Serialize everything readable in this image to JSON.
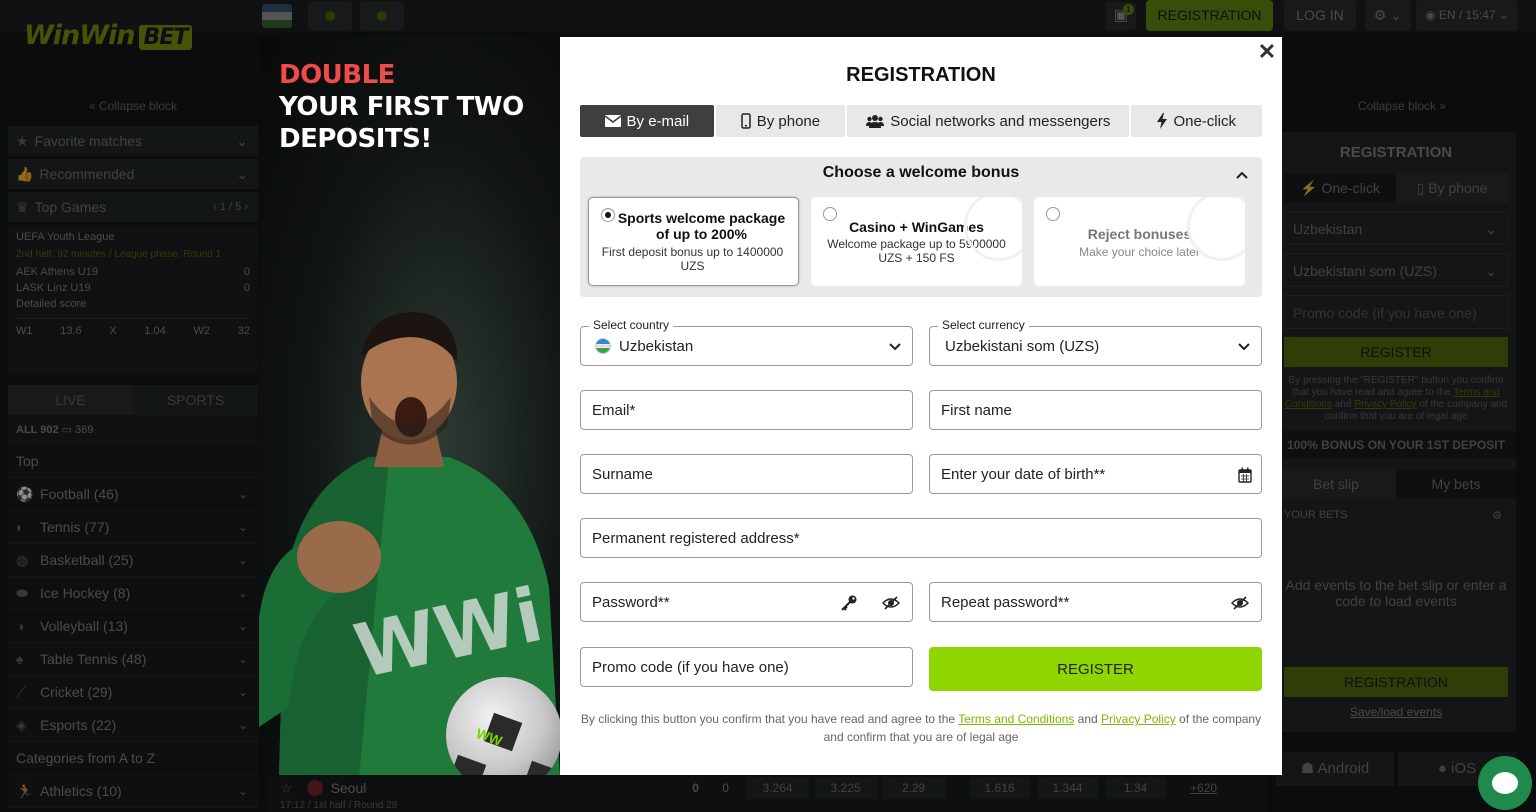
{
  "header": {
    "logo": {
      "part1": "WinWin",
      "part2": "BET"
    },
    "gift_badge": "1",
    "register_label": "REGISTRATION",
    "login_label": "LOG IN",
    "language": "EN",
    "time": "15:47"
  },
  "left_sidebar": {
    "collapse_label": "Collapse block",
    "items": [
      {
        "label": "Favorite matches",
        "icon": "star-icon"
      },
      {
        "label": "Recommended",
        "icon": "thumbs-up-icon"
      }
    ],
    "top_games": {
      "label": "Top Games",
      "pager": "1 / 5"
    },
    "match": {
      "league": "UEFA Youth League",
      "status": "2nd half, 92 minutes / League phase. Round 1",
      "team1": "AEK Athens U19",
      "score1": "0",
      "team2": "LASK Linz U19",
      "score2": "0",
      "detailed": "Detailed score",
      "odds": [
        {
          "k": "W1",
          "v": "13.6"
        },
        {
          "k": "X",
          "v": "1.04"
        },
        {
          "k": "W2",
          "v": "32"
        }
      ]
    },
    "tabs": {
      "live": "LIVE",
      "sports": "SPORTS"
    },
    "all_label": "ALL 902",
    "all_screen_count": "369",
    "top_label": "Top",
    "sports": [
      {
        "label": "Football (46)",
        "icon": "football-icon"
      },
      {
        "label": "Tennis (77)",
        "icon": "tennis-icon"
      },
      {
        "label": "Basketball (25)",
        "icon": "basketball-icon"
      },
      {
        "label": "Ice Hockey (8)",
        "icon": "ice-hockey-icon"
      },
      {
        "label": "Volleyball (13)",
        "icon": "volleyball-icon"
      },
      {
        "label": "Table Tennis (48)",
        "icon": "table-tennis-icon"
      },
      {
        "label": "Cricket (29)",
        "icon": "cricket-icon"
      },
      {
        "label": "Esports (22)",
        "icon": "gamepad-icon"
      }
    ],
    "categories_label": "Categories from A to Z",
    "athletics_label": "Athletics (10)"
  },
  "center_under": {
    "team": "Seoul",
    "info": "17:12 / 1st half / Round 28",
    "scores": [
      "0",
      "0"
    ],
    "odds": [
      "3.264",
      "3.225",
      "2.29",
      "1.616",
      "1.344",
      "1.34"
    ],
    "more": "+620"
  },
  "right_sidebar": {
    "collapse_label": "Collapse block",
    "title": "REGISTRATION",
    "tab_oneclick": "One-click",
    "tab_phone": "By phone",
    "country": "Uzbekistan",
    "currency": "Uzbekistani som (UZS)",
    "promo_placeholder": "Promo code (if you have one)",
    "register_button": "REGISTER",
    "note_1": "By pressing the \"REGISTER\" button you confirm that you have read and agree to the",
    "note_terms": "Terms and Conditions",
    "note_and": "and",
    "note_privacy": "Privacy Policy",
    "note_2": "of the company and confirm that you are of legal age",
    "bonus_banner": "100% BONUS ON YOUR 1ST DEPOSIT",
    "betslip_tab": "Bet slip",
    "mybets_tab": "My bets",
    "your_bets": "YOUR BETS",
    "empty_text": "Add events to the bet slip or enter a code to load events",
    "registration_button": "REGISTRATION",
    "saveload": "Save/load events",
    "android": "Android",
    "ios": "iOS"
  },
  "promo": {
    "line1": "DOUBLE",
    "line2": "YOUR FIRST TWO",
    "line3": "DEPOSITS!",
    "shirt_logo": "WWi",
    "ball_logo": "WW"
  },
  "modal": {
    "title": "REGISTRATION",
    "tabs": [
      {
        "label": "By e-mail",
        "icon": "envelope-icon",
        "active": true
      },
      {
        "label": "By phone",
        "icon": "phone-icon",
        "active": false
      },
      {
        "label": "Social networks and messengers",
        "icon": "users-icon",
        "active": false
      },
      {
        "label": "One-click",
        "icon": "lightning-icon",
        "active": false
      }
    ],
    "bonus": {
      "title": "Choose a welcome bonus",
      "options": [
        {
          "title": "Sports welcome package of up to 200%",
          "desc": "First deposit bonus up to 1400000 UZS",
          "selected": true
        },
        {
          "title": "Casino + WinGames",
          "desc": "Welcome package up to 5900000 UZS + 150 FS",
          "selected": false
        },
        {
          "title": "Reject bonuses",
          "desc": "Make your choice later",
          "selected": false
        }
      ]
    },
    "country": {
      "label": "Select country",
      "value": "Uzbekistan"
    },
    "currency": {
      "label": "Select currency",
      "value": "Uzbekistani som (UZS)"
    },
    "fields": {
      "email": "Email*",
      "first_name": "First name",
      "surname": "Surname",
      "dob": "Enter your date of birth**",
      "address": "Permanent registered address*",
      "password": "Password**",
      "repeat_password": "Repeat password**",
      "promo": "Promo code (if you have one)"
    },
    "register_button": "REGISTER",
    "terms": {
      "prefix": "By clicking this button you confirm that you have read and agree to the",
      "terms_link": "Terms and Conditions",
      "and": "and",
      "privacy_link": "Privacy Policy",
      "suffix": "of the company and confirm that you are of legal age"
    }
  },
  "colors": {
    "accent_green": "#8fd600",
    "modal_tab_active": "#3f3f3f",
    "promo_red": "#ef4b4b",
    "link_green": "#7cb800"
  }
}
